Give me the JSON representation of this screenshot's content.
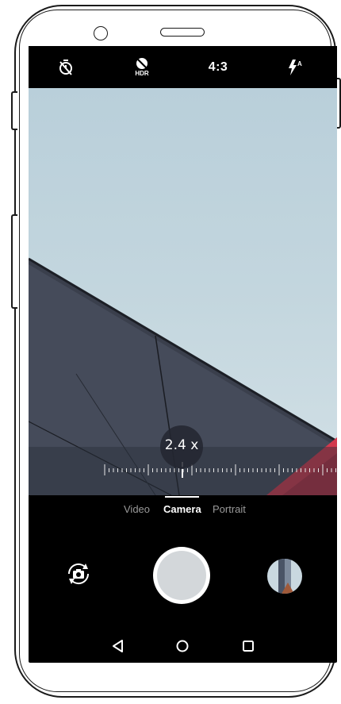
{
  "topbar": {
    "timer_icon": "timer-off-icon",
    "hdr_icon": "hdr-off-icon",
    "hdr_label": "HDR",
    "aspect_ratio": "4:3",
    "flash_icon": "flash-auto-icon",
    "flash_badge": "A"
  },
  "viewfinder": {
    "zoom_level": "2.4 x"
  },
  "modes": {
    "items": [
      {
        "label": "Video"
      },
      {
        "label": "Camera"
      },
      {
        "label": "Portrait"
      }
    ],
    "active": "Camera"
  },
  "controls": {
    "flip_icon": "switch-camera-icon",
    "shutter_icon": "shutter-button",
    "gallery_icon": "gallery-thumbnail"
  },
  "navbar": {
    "back_icon": "back-triangle-icon",
    "home_icon": "home-circle-icon",
    "recents_icon": "recents-square-icon"
  },
  "colors": {
    "sky": "#c3d6de",
    "building": "#3a3f4c",
    "red_roof": "#d23a4e",
    "shutter_fill": "#d3d7da"
  }
}
